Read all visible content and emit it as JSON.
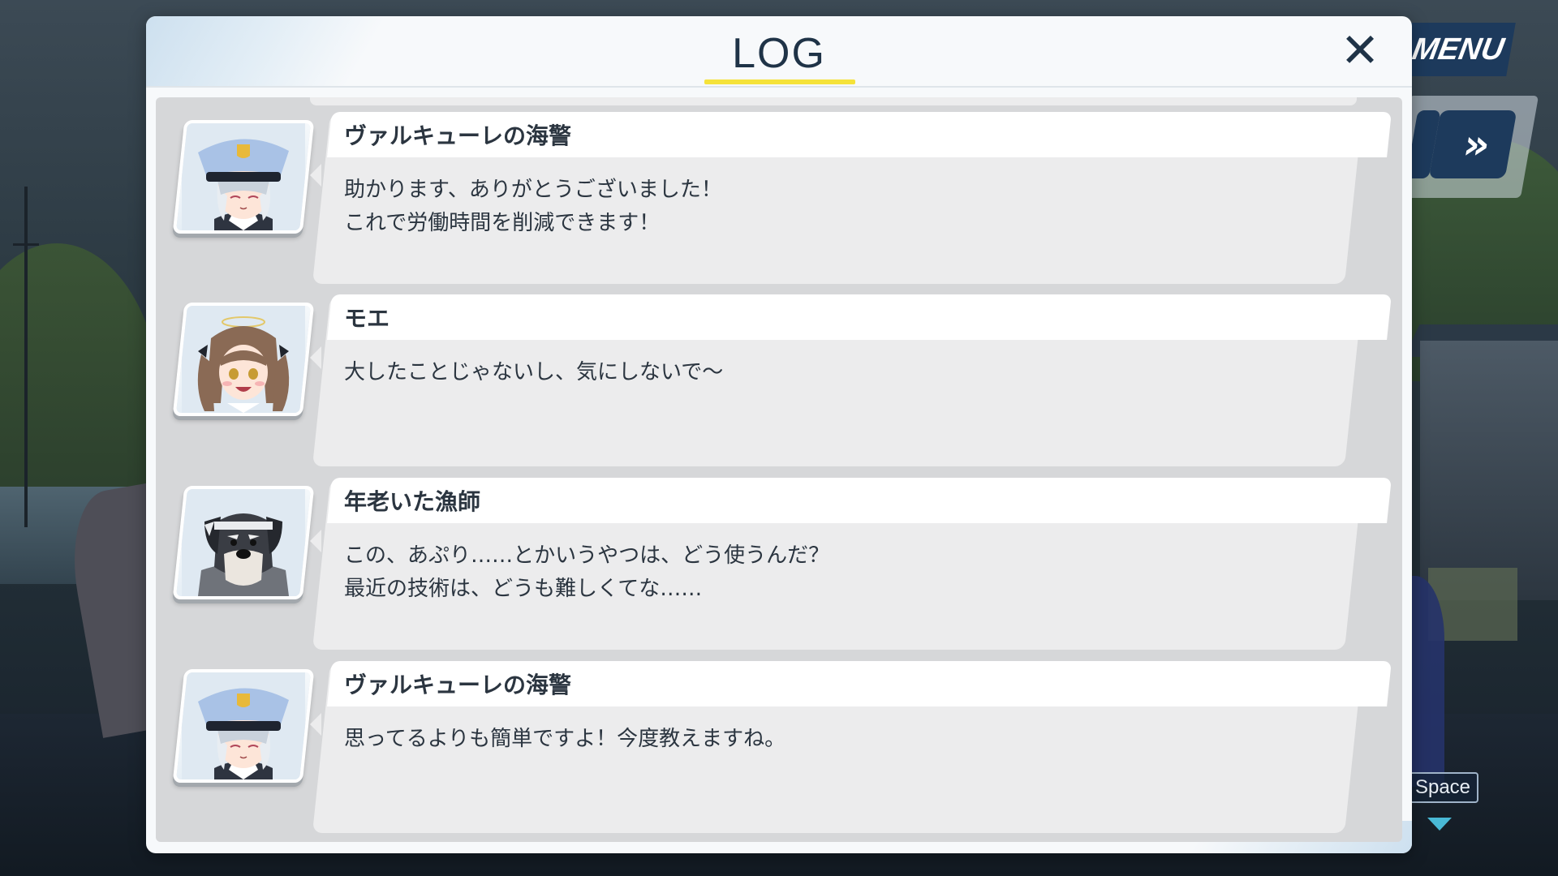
{
  "hud": {
    "menu_label": "MENU",
    "skip_label": "»",
    "space_label": "Space"
  },
  "log": {
    "title": "LOG",
    "close_label": "✕",
    "accent_color": "#f5e23a",
    "entries": [
      {
        "speaker": "ヴァルキューレの海警",
        "portrait": "valkyrie-police-portrait",
        "text": "助かります、ありがとうございました！\nこれで労働時間を削減できます！"
      },
      {
        "speaker": "モエ",
        "portrait": "moe-portrait",
        "text": "大したことじゃないし、気にしないで～"
      },
      {
        "speaker": "年老いた漁師",
        "portrait": "old-fisherman-dog-portrait",
        "text": "この、あぷり‥‥‥とかいうやつは、どう使うんだ？\n最近の技術は、どうも難しくてな‥‥‥"
      },
      {
        "speaker": "ヴァルキューレの海警",
        "portrait": "valkyrie-police-portrait",
        "text": "思ってるよりも簡単ですよ！今度教えますね。"
      }
    ]
  }
}
